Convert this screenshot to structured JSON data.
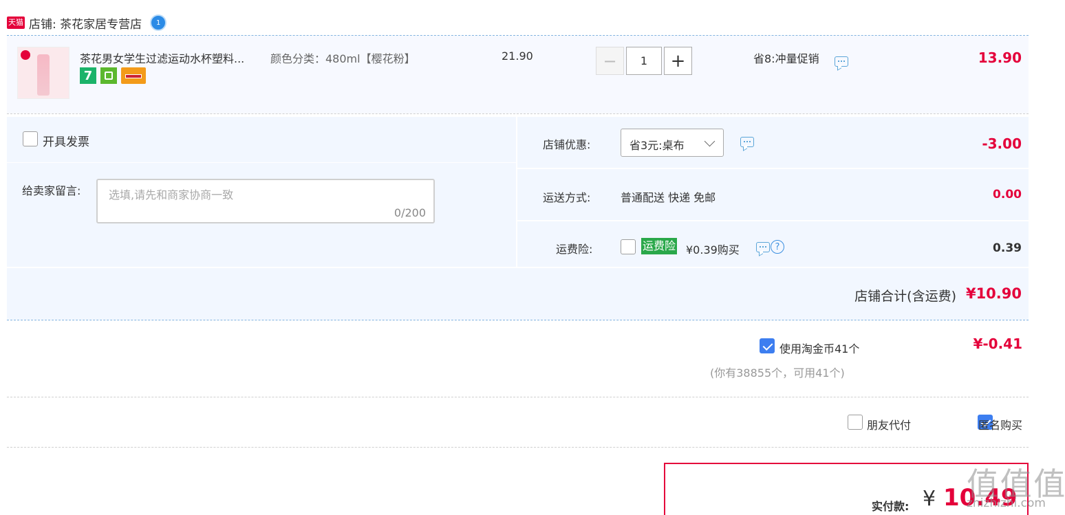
{
  "store": {
    "badge": "天猫",
    "title": "店铺: 茶花家居专营店",
    "chat_badge": "1"
  },
  "item": {
    "name": "茶花男女学生过滤运动水杯塑料...",
    "spec": "颜色分类：480ml【樱花粉】",
    "price": "21.90",
    "quantity": "1",
    "promo": "省8:冲量促销",
    "subtotal": "13.90",
    "service_badge_7": "7"
  },
  "invoice": {
    "label": "开具发票"
  },
  "message": {
    "label": "给卖家留言:",
    "placeholder": "选填,请先和商家协商一致",
    "count": "0/200"
  },
  "discount": {
    "label": "店铺优惠:",
    "selected": "省3元:桌布",
    "amount": "-3.00"
  },
  "shipping": {
    "label": "运送方式:",
    "value": "普通配送 快递 免邮",
    "amount": "0.00"
  },
  "insurance": {
    "label": "运费险:",
    "tag": "运费险",
    "price": "¥0.39购买",
    "amount": "0.39",
    "help": "?"
  },
  "store_total": {
    "label": "店铺合计(含运费)",
    "amount": "¥10.90"
  },
  "coins": {
    "label": "使用淘金币41个",
    "amount": "¥-0.41",
    "note": "(你有38855个，可用41个)"
  },
  "options": {
    "friend_pay": "朋友代付",
    "anonymous": "匿名购买"
  },
  "payment": {
    "label": "实付款:",
    "currency": "¥",
    "amount": "10.49"
  },
  "watermark": "值  值  值",
  "watermark_url": "zhizhizhi.com"
}
